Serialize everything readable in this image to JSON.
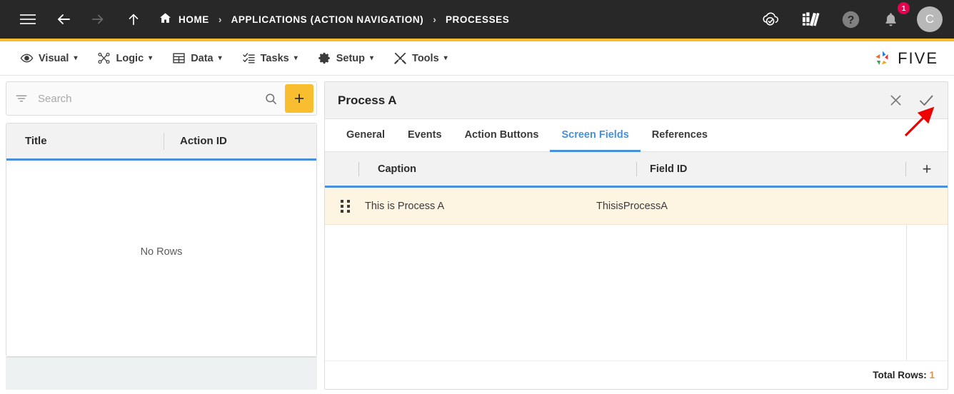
{
  "topbar": {
    "icons": {
      "menu": "hamburger-icon",
      "back": "back-arrow-icon",
      "forward": "forward-arrow-icon",
      "up": "up-arrow-icon",
      "home": "home-icon",
      "cloud": "cloud-check-icon",
      "library": "books-icon",
      "help": "help-circle-icon",
      "bell": "notification-bell-icon"
    },
    "breadcrumb": [
      {
        "label": "HOME"
      },
      {
        "label": "APPLICATIONS (ACTION NAVIGATION)"
      },
      {
        "label": "PROCESSES"
      }
    ],
    "separator": "›",
    "notification_count": "1",
    "avatar_initial": "C",
    "accent_color": "#f9be30"
  },
  "menubar": {
    "items": [
      {
        "label": "Visual",
        "icon": "eye-icon"
      },
      {
        "label": "Logic",
        "icon": "nodes-icon"
      },
      {
        "label": "Data",
        "icon": "table-grid-icon"
      },
      {
        "label": "Tasks",
        "icon": "checklist-icon"
      },
      {
        "label": "Setup",
        "icon": "gear-icon"
      },
      {
        "label": "Tools",
        "icon": "tools-icon"
      }
    ],
    "caret": "▾",
    "logo_text": "FIVE"
  },
  "left_panel": {
    "search": {
      "placeholder": "Search",
      "value": "",
      "filter_icon": "filter-icon",
      "search_icon": "magnifier-icon",
      "add_label": "+"
    },
    "columns": [
      "Title",
      "Action ID"
    ],
    "empty_message": "No Rows",
    "rows": []
  },
  "right_panel": {
    "title": "Process A",
    "actions": {
      "close": "✕",
      "confirm": "✓"
    },
    "tabs": [
      {
        "label": "General",
        "active": false
      },
      {
        "label": "Events",
        "active": false
      },
      {
        "label": "Action Buttons",
        "active": false
      },
      {
        "label": "Screen Fields",
        "active": true
      },
      {
        "label": "References",
        "active": false
      }
    ],
    "grid": {
      "columns": [
        "Caption",
        "Field ID"
      ],
      "add_label": "+",
      "rows": [
        {
          "caption": "This is Process A",
          "field_id": "ThisisProcessA"
        }
      ],
      "total_label": "Total Rows:",
      "total_value": "1"
    }
  },
  "colors": {
    "accent_blue": "#4a90d9",
    "accent_amber": "#f9be30",
    "row_highlight": "#fdf5e2",
    "badge_pink": "#e8004f"
  }
}
